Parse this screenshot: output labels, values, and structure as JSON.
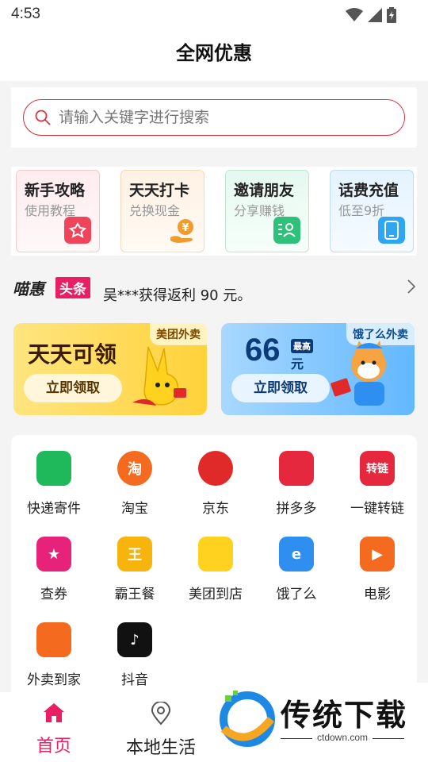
{
  "status": {
    "time": "4:53"
  },
  "header": {
    "title": "全网优惠"
  },
  "search": {
    "placeholder": "请输入关键字进行搜索"
  },
  "quick_cards": [
    {
      "title": "新手攻略",
      "subtitle": "使用教程",
      "icon": "gift-icon",
      "color": "#f0445b"
    },
    {
      "title": "天天打卡",
      "subtitle": "兑换现金",
      "icon": "coin-hand-icon",
      "color": "#f39a2d"
    },
    {
      "title": "邀请朋友",
      "subtitle": "分享赚钱",
      "icon": "invite-icon",
      "color": "#2fc07a"
    },
    {
      "title": "话费充值",
      "subtitle": "低至9折",
      "icon": "phone-icon",
      "color": "#2fa6f2"
    }
  ],
  "news": {
    "logo": "喵惠",
    "tag": "头条",
    "text": "吴***获得返利 90 元。"
  },
  "banners": [
    {
      "tag": "美团外卖",
      "headline": "天天可领",
      "button": "立即领取"
    },
    {
      "tag": "饿了么外卖",
      "amount": "66",
      "amount_tag": "最高",
      "unit": "元",
      "button": "立即领取"
    }
  ],
  "grid": [
    {
      "label": "快递寄件",
      "icon": "package-icon",
      "color": "#1fb85a",
      "glyph": ""
    },
    {
      "label": "淘宝",
      "icon": "taobao-icon",
      "color": "#f46a1f",
      "glyph": "淘"
    },
    {
      "label": "京东",
      "icon": "jd-icon",
      "color": "#e02a2a",
      "glyph": ""
    },
    {
      "label": "拼多多",
      "icon": "pinduoduo-icon",
      "color": "#e5283e",
      "glyph": ""
    },
    {
      "label": "一键转链",
      "icon": "convert-link-icon",
      "color": "#e5283e",
      "glyph": "转链"
    },
    {
      "label": "查券",
      "icon": "coupon-icon",
      "color": "#e6227a",
      "glyph": "★"
    },
    {
      "label": "霸王餐",
      "icon": "meal-icon",
      "color": "#f6b40c",
      "glyph": "王"
    },
    {
      "label": "美团到店",
      "icon": "meituan-icon",
      "color": "#ffd21f",
      "glyph": ""
    },
    {
      "label": "饿了么",
      "icon": "eleme-icon",
      "color": "#2f8ff0",
      "glyph": "e"
    },
    {
      "label": "电影",
      "icon": "movie-icon",
      "color": "#f46a1f",
      "glyph": "▶"
    },
    {
      "label": "外卖到家",
      "icon": "takeout-icon",
      "color": "#f46a1f",
      "glyph": ""
    },
    {
      "label": "抖音",
      "icon": "douyin-icon",
      "color": "#111111",
      "glyph": "♪"
    }
  ],
  "tabs": [
    {
      "label": "首页",
      "icon": "home-icon",
      "active": true
    },
    {
      "label": "本地生活",
      "icon": "location-pin-icon",
      "active": false
    }
  ],
  "watermark": {
    "text": "传统下载",
    "url": "ctdown.com"
  },
  "colors": {
    "accent": "#e0303f",
    "active_tab": "#e91e63"
  }
}
